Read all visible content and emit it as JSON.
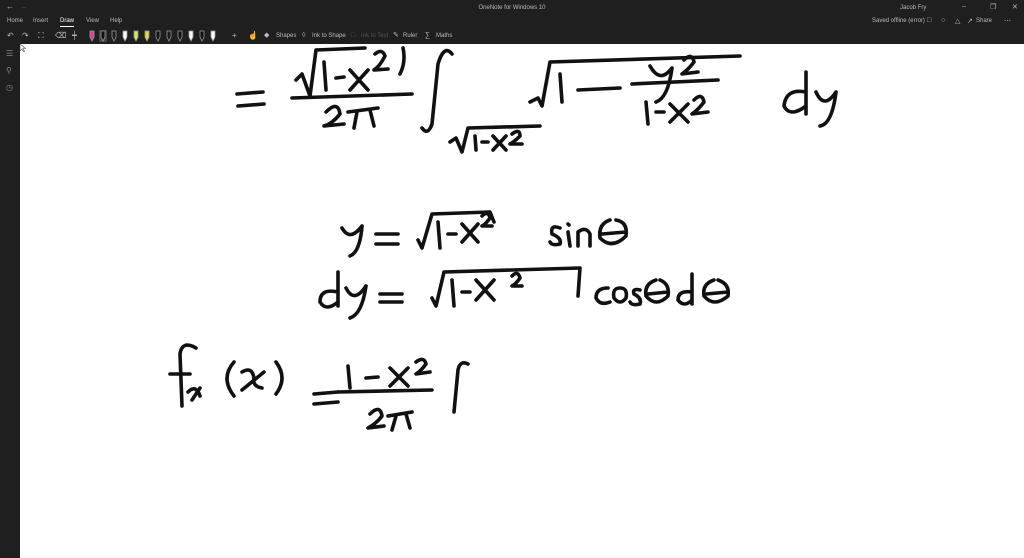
{
  "titlebar": {
    "app_title": "OneNote for Windows 10",
    "user_name": "Jacob Fry",
    "back_icon": "arrow-left-icon",
    "forward_icon": "arrow-right-icon",
    "minimize_glyph": "–",
    "maximize_glyph": "❐",
    "close_glyph": "✕"
  },
  "menubar": {
    "tabs": [
      "Home",
      "Insert",
      "Draw",
      "View",
      "Help"
    ],
    "active_tab": "Draw",
    "status": "Saved offline (error)",
    "share_label": "Share"
  },
  "toolbar": {
    "undo_glyph": "↶",
    "redo_glyph": "↷",
    "lasso_glyph": "⛶",
    "eraser_glyph": "⌫",
    "insert_space_glyph": "┿",
    "add_pen_glyph": "+",
    "shapes_label": "Shapes",
    "ink_to_shape_label": "Ink to Shape",
    "ink_to_text_label": "Ink to Text",
    "ruler_label": "Ruler",
    "maths_label": "Maths",
    "pens": [
      {
        "color": "#e0399a"
      },
      {
        "color": "#111111"
      },
      {
        "color": "#1b1b1b"
      },
      {
        "color": "#ffffff"
      },
      {
        "color": "#d8e64a"
      },
      {
        "color": "#e6d43a"
      },
      {
        "color": "#111111"
      },
      {
        "color": "#1a1a1a"
      },
      {
        "color": "#111111"
      },
      {
        "color": "#ffffff"
      },
      {
        "color": "#111111"
      },
      {
        "color": "#ffffff"
      }
    ],
    "selected_pen_index": 1
  },
  "sidebar": {
    "icons": [
      "notebooks-icon",
      "search-icon",
      "recent-icon"
    ]
  },
  "colors": {
    "chrome_bg": "#1f1f1f",
    "page_bg": "#ffffff",
    "ink": "#111111"
  }
}
